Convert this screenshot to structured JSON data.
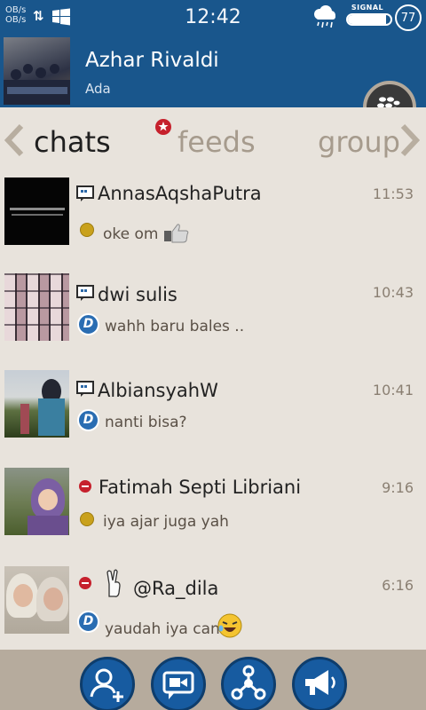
{
  "status_bar": {
    "net_line1": "OB/s",
    "net_line2": "OB/s",
    "clock": "12:42",
    "signal_label": "SIGNAL",
    "signal_level": 0.9,
    "battery": "77"
  },
  "profile": {
    "name": "Azhar Rivaldi",
    "status": "Ada"
  },
  "tabs": [
    {
      "label": "chats",
      "active": true
    },
    {
      "label": "feeds",
      "active": false
    },
    {
      "label": "group",
      "active": false
    }
  ],
  "chats": [
    {
      "name": "AnnasAqshaPutra",
      "time": "11:53",
      "message": "oke om",
      "status": "yellow"
    },
    {
      "name": "dwi sulis",
      "time": "10:43",
      "message": "wahh baru bales ..",
      "status": "delivered"
    },
    {
      "name": "AlbiansyahW",
      "time": "10:41",
      "message": "nanti bisa?",
      "status": "delivered"
    },
    {
      "name": "Fatimah Septi Libriani",
      "time": "9:16",
      "message": "iya ajar juga yah",
      "status": "yellow"
    },
    {
      "name": "@Ra_dila",
      "time": "6:16",
      "message": "yaudah iya cans",
      "status": "delivered"
    }
  ],
  "colors": {
    "header_blue": "#19568c",
    "background": "#e8e3dc",
    "tab_inactive": "#a69b8d",
    "bottom_bar": "#b6ab9d",
    "button_blue": "#175ba0",
    "busy_red": "#c6202c",
    "status_yellow": "#c9a11c"
  },
  "icons": {
    "status_bar": [
      "data-arrows-icon",
      "windows-icon",
      "weather-icon",
      "battery-icon"
    ],
    "header": [
      "bbm-new-chat-icon"
    ],
    "bottom_bar": [
      "add-contact-icon",
      "video-chat-icon",
      "share-icon",
      "broadcast-icon"
    ]
  }
}
